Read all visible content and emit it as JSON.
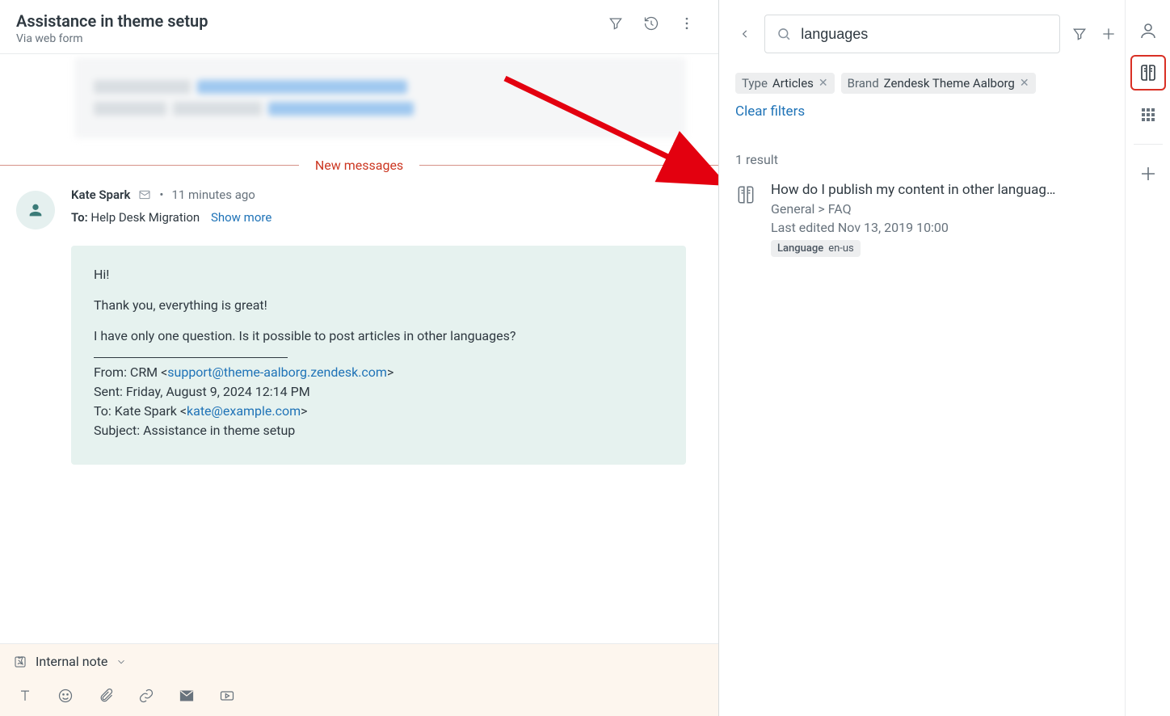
{
  "ticket": {
    "title": "Assistance in theme setup",
    "via": "Via web form"
  },
  "divider_label": "New messages",
  "message": {
    "sender": "Kate Spark",
    "timestamp": "11 minutes ago",
    "to_label": "To:",
    "to_value": "Help Desk Migration",
    "show_more": "Show more",
    "greeting": "Hi!",
    "body1": "Thank you, everything is great!",
    "body2": "I have only one question. Is it possible to post articles in other languages?",
    "forward_from_prefix": "From: CRM <",
    "forward_from_email": "support@theme-aalborg.zendesk.com",
    "forward_from_suffix": ">",
    "forward_sent": "Sent: Friday, August 9, 2024 12:14 PM",
    "forward_to_prefix": "To: Kate Spark <",
    "forward_to_email": "kate@example.com",
    "forward_to_suffix": ">",
    "forward_subject": "Subject: Assistance in theme setup"
  },
  "composer": {
    "mode": "Internal note"
  },
  "kb": {
    "search_value": "languages",
    "chips": [
      {
        "key": "Type",
        "value": "Articles"
      },
      {
        "key": "Brand",
        "value": "Zendesk Theme Aalborg"
      }
    ],
    "clear_label": "Clear filters",
    "result_count": "1 result",
    "result": {
      "title": "How do I publish my content in other languag…",
      "path": "General > FAQ",
      "edited": "Last edited Nov 13, 2019 10:00",
      "tag_key": "Language",
      "tag_value": "en-us"
    }
  }
}
